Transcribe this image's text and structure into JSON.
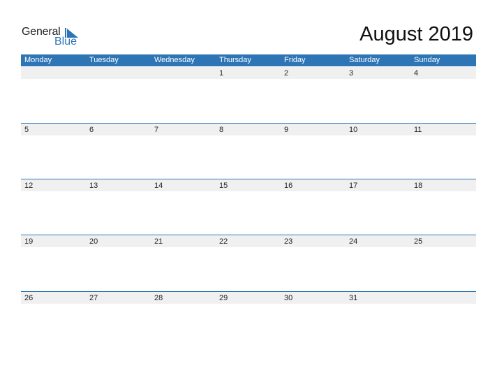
{
  "logo": {
    "general": "General",
    "blue": "Blue"
  },
  "title": "August 2019",
  "colors": {
    "accent": "#2e75b6",
    "date_strip": "#f0f0f0"
  },
  "days": [
    "Monday",
    "Tuesday",
    "Wednesday",
    "Thursday",
    "Friday",
    "Saturday",
    "Sunday"
  ],
  "weeks": [
    [
      "",
      "",
      "",
      "1",
      "2",
      "3",
      "4"
    ],
    [
      "5",
      "6",
      "7",
      "8",
      "9",
      "10",
      "11"
    ],
    [
      "12",
      "13",
      "14",
      "15",
      "16",
      "17",
      "18"
    ],
    [
      "19",
      "20",
      "21",
      "22",
      "23",
      "24",
      "25"
    ],
    [
      "26",
      "27",
      "28",
      "29",
      "30",
      "31",
      ""
    ]
  ]
}
